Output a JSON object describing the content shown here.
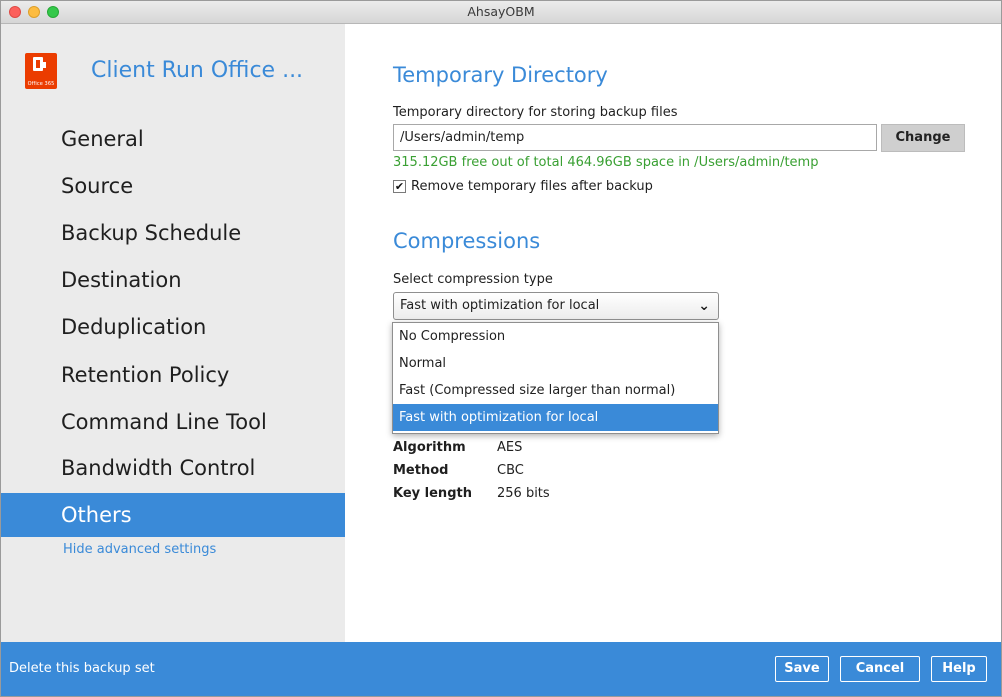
{
  "window": {
    "title": "AhsayOBM"
  },
  "sidebar": {
    "app_title": "Client Run Office ...",
    "logo_text": "Office 365",
    "items": [
      {
        "label": "General"
      },
      {
        "label": "Source"
      },
      {
        "label": "Backup Schedule"
      },
      {
        "label": "Destination"
      },
      {
        "label": "Deduplication"
      },
      {
        "label": "Retention Policy"
      },
      {
        "label": "Command Line Tool"
      },
      {
        "label": "Bandwidth Control"
      },
      {
        "label": "Others",
        "selected": true
      }
    ],
    "advanced_link": "Hide advanced settings"
  },
  "temp_dir": {
    "section_title": "Temporary Directory",
    "field_label": "Temporary directory for storing backup files",
    "path_value": "/Users/admin/temp",
    "change_button": "Change",
    "free_space_text": "315.12GB free out of total 464.96GB space in /Users/admin/temp",
    "remove_checkbox_checked": true,
    "remove_checkbox_mark": "✔",
    "remove_checkbox_label": "Remove temporary files after backup"
  },
  "compression": {
    "section_title": "Compressions",
    "field_label": "Select compression type",
    "selected_value": "Fast with optimization for local",
    "options": [
      "No Compression",
      "Normal",
      "Fast (Compressed size larger than normal)",
      "Fast with optimization for local"
    ],
    "highlighted_option_index": 3
  },
  "encryption": {
    "rows": [
      {
        "key": "Algorithm",
        "value": "AES"
      },
      {
        "key": "Method",
        "value": "CBC"
      },
      {
        "key": "Key length",
        "value": "256 bits"
      }
    ]
  },
  "footer": {
    "delete_link": "Delete this backup set",
    "save": "Save",
    "cancel": "Cancel",
    "help": "Help"
  },
  "colors": {
    "accent": "#3a8ad8",
    "sidebar_bg": "#ebebeb",
    "free_space_text": "#3aa033",
    "office_logo": "#eb3c00"
  }
}
